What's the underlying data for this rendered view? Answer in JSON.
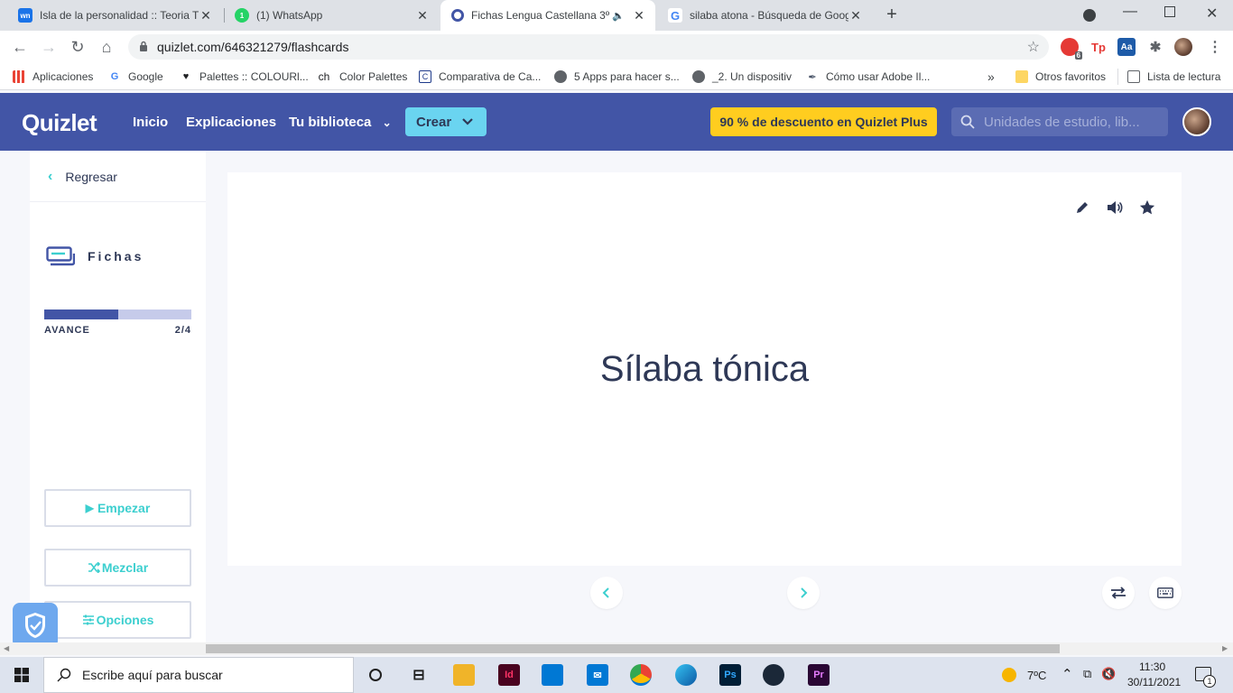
{
  "browser": {
    "tabs": [
      {
        "title": "Isla de la personalidad :: Teoria TI",
        "favicon": "wn"
      },
      {
        "title": "(1) WhatsApp",
        "favicon": "1"
      },
      {
        "title": "Fichas Lengua Castellana 3º",
        "favicon": "Q"
      },
      {
        "title": "silaba atona - Búsqueda de Goog",
        "favicon": "G"
      }
    ],
    "url": "quizlet.com/646321279/flashcards",
    "ext_badge": "6",
    "bookmarks": [
      {
        "label": "Aplicaciones"
      },
      {
        "label": "Google"
      },
      {
        "label": "Palettes :: COLOURl..."
      },
      {
        "label": "Color Palettes"
      },
      {
        "label": "Comparativa de Ca..."
      },
      {
        "label": "5 Apps para hacer s..."
      },
      {
        "label": "_2. Un dispositiv"
      },
      {
        "label": "Cómo usar Adobe Il..."
      },
      {
        "label": "Otros favoritos"
      },
      {
        "label": "Lista de lectura"
      }
    ]
  },
  "header": {
    "logo": "Quizlet",
    "nav": [
      "Inicio",
      "Explicaciones",
      "Tu biblioteca"
    ],
    "create_label": "Crear",
    "promo": "90 % de descuento en Quizlet Plus",
    "search_placeholder": "Unidades de estudio, lib..."
  },
  "sidebar": {
    "back_label": "Regresar",
    "mode_label": "Fichas",
    "progress_label": "AVANCE",
    "progress_count": "2/4",
    "progress_fraction": 0.5,
    "start_label": "Empezar",
    "shuffle_label": "Mezclar",
    "options_label": "Opciones"
  },
  "card": {
    "term": "Sílaba tónica"
  },
  "taskbar": {
    "search_placeholder": "Escribe aquí para buscar",
    "weather": "7ºC",
    "time": "11:30",
    "date": "30/11/2021",
    "notif_count": "1"
  },
  "colors": {
    "quizlet_blue": "#4255a6",
    "accent_teal": "#3ccfcf",
    "promo_yellow": "#ffcd1f"
  }
}
